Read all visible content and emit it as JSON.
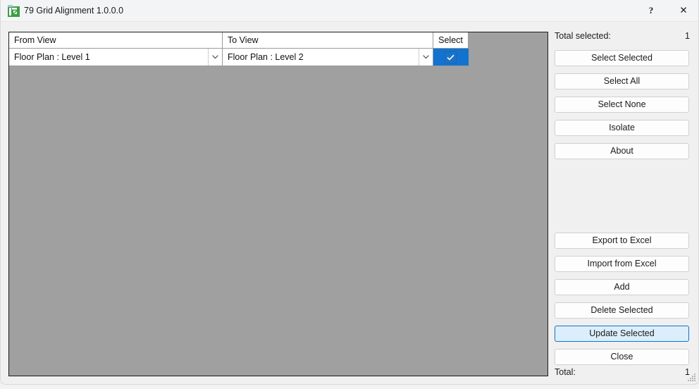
{
  "window": {
    "title": "79 Grid Alignment 1.0.0.0",
    "app_icon": "grid-alignment-icon",
    "help_glyph": "?",
    "close_glyph": "✕",
    "accent_color": "#0f74c8",
    "selection_color": "#1273cf",
    "grid_background_color": "#a0a0a0",
    "body_color": "#f0f0f0"
  },
  "grid": {
    "columns": [
      {
        "key": "from_view",
        "label": "From View"
      },
      {
        "key": "to_view",
        "label": "To View"
      },
      {
        "key": "select",
        "label": "Select"
      }
    ],
    "rows": [
      {
        "from_view": "Floor Plan : Level 1",
        "to_view": "Floor Plan : Level 2",
        "selected": true,
        "check_glyph": "✓",
        "dropdown_icon": "chevron-down-icon"
      }
    ]
  },
  "side_panel": {
    "total_selected_label": "Total selected:",
    "total_selected_value": "1",
    "top_buttons": [
      {
        "name": "select-selected-button",
        "label": "Select Selected",
        "focused": false
      },
      {
        "name": "select-all-button",
        "label": "Select All",
        "focused": false
      },
      {
        "name": "select-none-button",
        "label": "Select None",
        "focused": false
      },
      {
        "name": "isolate-button",
        "label": "Isolate",
        "focused": false
      },
      {
        "name": "about-button",
        "label": "About",
        "focused": false
      }
    ],
    "bottom_buttons": [
      {
        "name": "export-to-excel-button",
        "label": "Export to Excel",
        "focused": false
      },
      {
        "name": "import-from-excel-button",
        "label": "Import from Excel",
        "focused": false
      },
      {
        "name": "add-button",
        "label": "Add",
        "focused": false
      },
      {
        "name": "delete-selected-button",
        "label": "Delete Selected",
        "focused": false
      },
      {
        "name": "update-selected-button",
        "label": "Update Selected",
        "focused": true
      },
      {
        "name": "close-button",
        "label": "Close",
        "focused": false
      }
    ],
    "total_label": "Total:",
    "total_value": "1"
  }
}
